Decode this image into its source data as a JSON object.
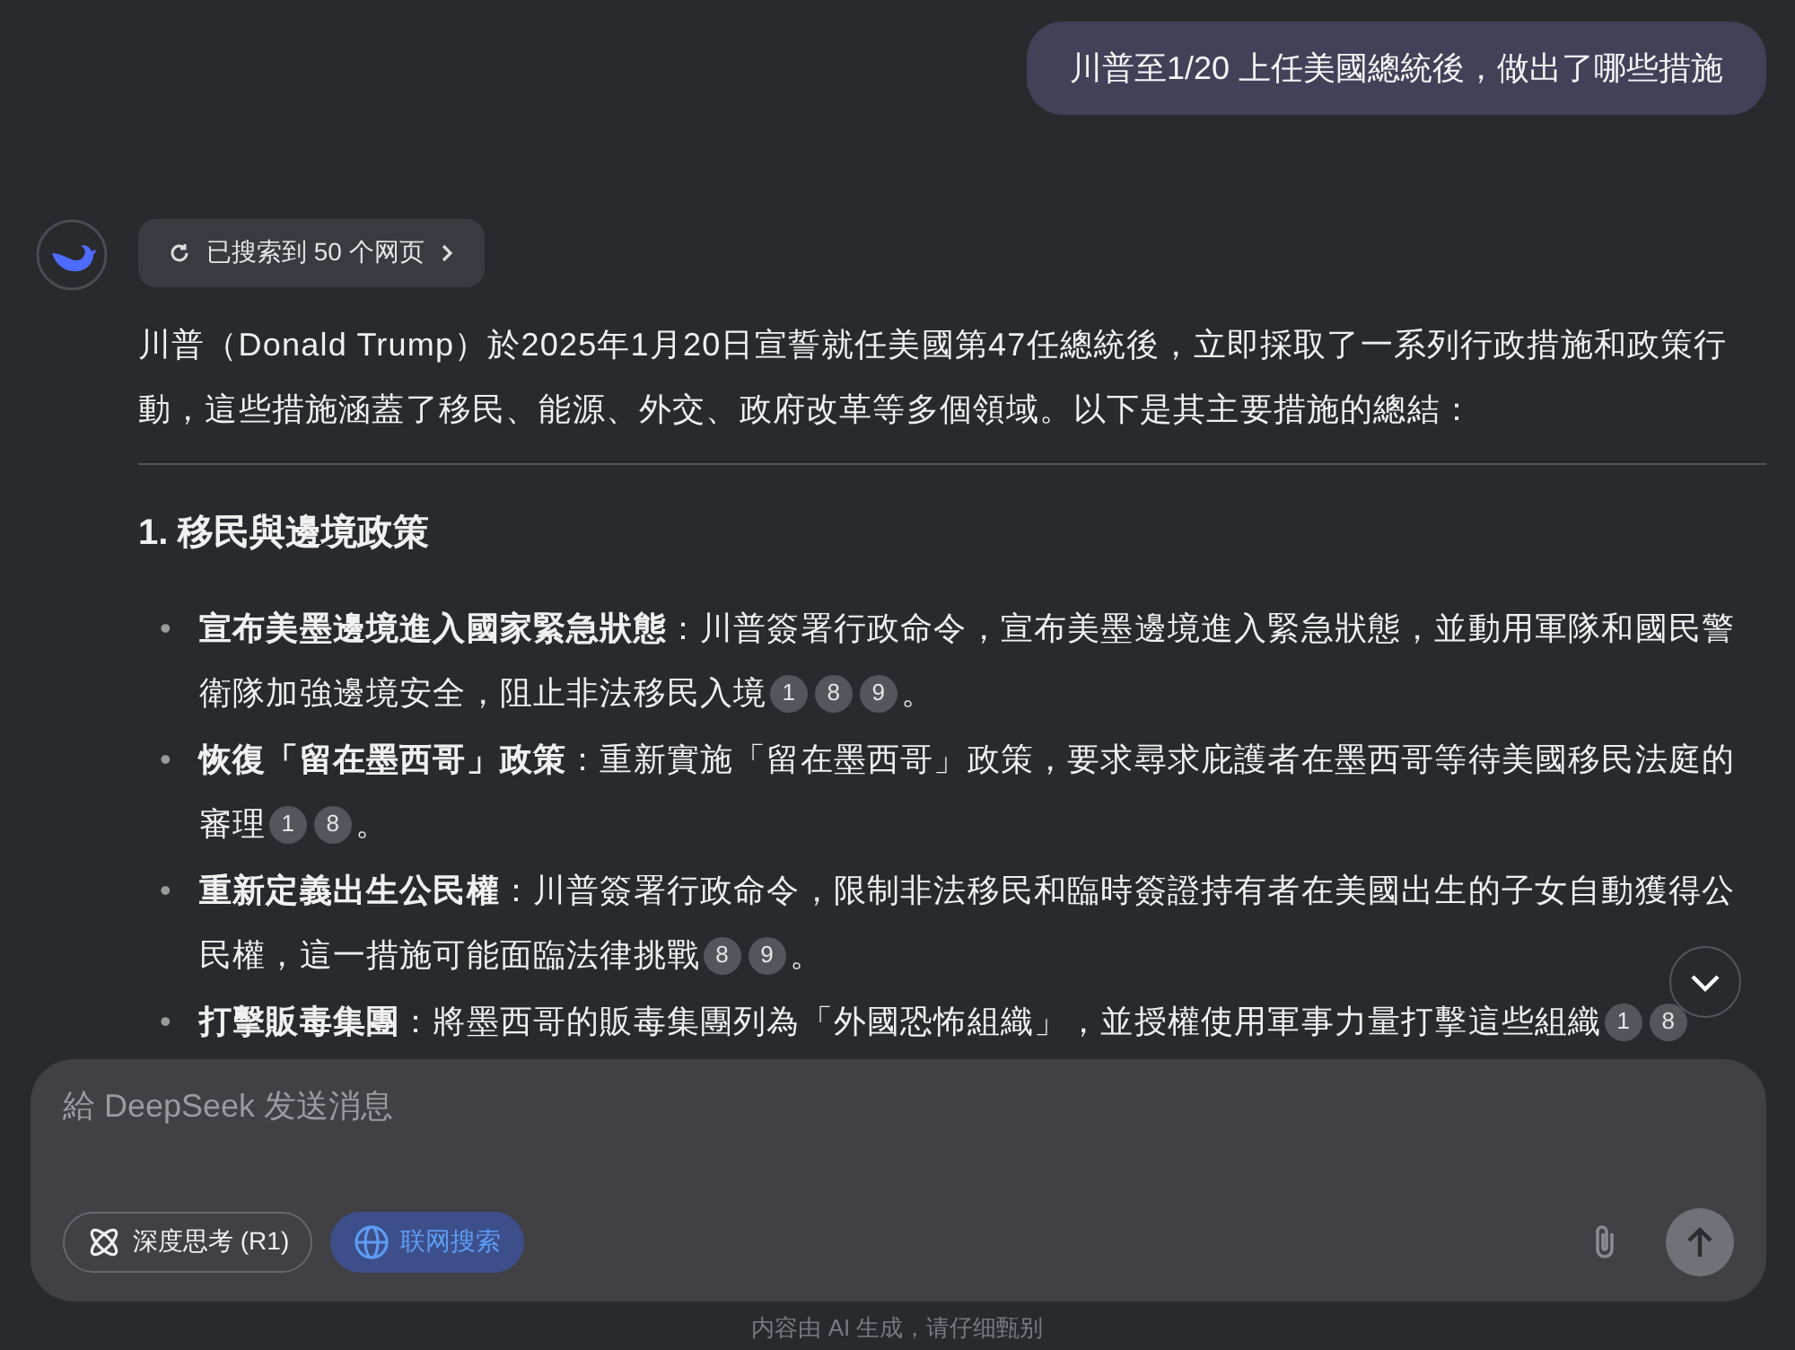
{
  "user_message": "川普至1/20 上任美國總統後，做出了哪些措施",
  "search_chip": {
    "label": "已搜索到 50 个网页"
  },
  "intro": "川普（Donald Trump）於2025年1月20日宣誓就任美國第47任總統後，立即採取了一系列行政措施和政策行動，這些措施涵蓋了移民、能源、外交、政府改革等多個領域。以下是其主要措施的總結：",
  "section_heading": "1. 移民與邊境政策",
  "bullets": [
    {
      "marker": "•",
      "title": "宣布美墨邊境進入國家緊急狀態",
      "text": "：川普簽署行政命令，宣布美墨邊境進入緊急狀態，並動用軍隊和國民警衛隊加強邊境安全，阻止非法移民入境",
      "citations": [
        "1",
        "8",
        "9"
      ],
      "end": "。"
    },
    {
      "marker": "•",
      "title": "恢復「留在墨西哥」政策",
      "text": "：重新實施「留在墨西哥」政策，要求尋求庇護者在墨西哥等待美國移民法庭的審理",
      "citations": [
        "1",
        "8"
      ],
      "end": "。"
    },
    {
      "marker": "•",
      "title": "重新定義出生公民權",
      "text": "：川普簽署行政命令，限制非法移民和臨時簽證持有者在美國出生的子女自動獲得公民權，這一措施可能面臨法律挑戰",
      "citations": [
        "8",
        "9"
      ],
      "end": "。"
    },
    {
      "marker": "•",
      "title": "打擊販毒集團",
      "text": "：將墨西哥的販毒集團列為「外國恐怖組織」，並授權使用軍事力量打擊這些組織",
      "citations": [
        "1",
        "8"
      ]
    }
  ],
  "composer": {
    "placeholder": "給 DeepSeek 发送消息",
    "toggles": [
      {
        "kind": "think",
        "label": "深度思考 (R1)",
        "selected": false
      },
      {
        "kind": "web",
        "label": "联网搜索",
        "selected": true
      }
    ],
    "send_disabled": true
  },
  "footer": "内容由 AI 生成，请仔细甄别"
}
